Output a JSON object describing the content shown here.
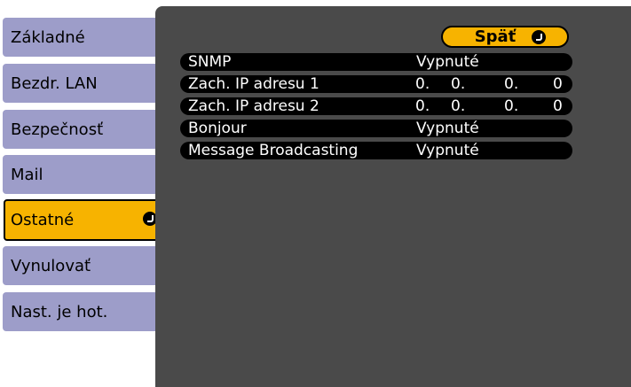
{
  "sidebar": {
    "items": [
      {
        "label": "Základné"
      },
      {
        "label": "Bezdr. LAN"
      },
      {
        "label": "Bezpečnosť"
      },
      {
        "label": "Mail"
      },
      {
        "label": "Ostatné",
        "active": true
      },
      {
        "label": "Vynulovať"
      },
      {
        "label": "Nast. je hot."
      }
    ]
  },
  "panel": {
    "back_label": "Späť",
    "rows": [
      {
        "label": "SNMP",
        "value": "Vypnuté"
      },
      {
        "label": "Zach. IP adresu 1",
        "ip": [
          "0.",
          "0.",
          "0.",
          "0"
        ]
      },
      {
        "label": "Zach. IP adresu 2",
        "ip": [
          "0.",
          "0.",
          "0.",
          "0"
        ]
      },
      {
        "label": "Bonjour",
        "value": "Vypnuté"
      },
      {
        "label": "Message Broadcasting",
        "value": "Vypnuté"
      }
    ]
  },
  "colors": {
    "tab": "#9d9dc9",
    "active": "#f7b300",
    "panel": "#4a4a4a",
    "row": "#000000"
  },
  "icons": {
    "enter": "enter-icon"
  }
}
